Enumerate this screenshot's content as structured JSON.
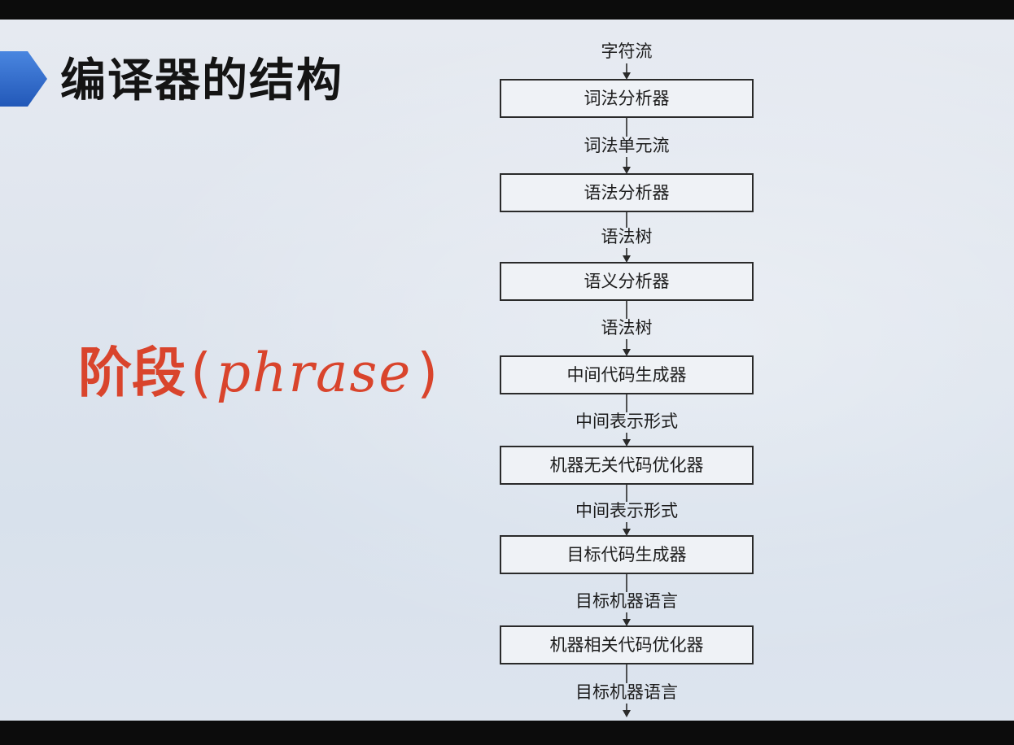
{
  "slide": {
    "title": "编译器的结构",
    "phase_label": {
      "zh": "阶段",
      "open_paren": "(",
      "en": "phrase",
      "close_paren": ")"
    },
    "colors": {
      "title": "#141414",
      "phase_label": "#d9442c",
      "title_marker": "#2f6fd1"
    }
  },
  "flowchart": {
    "input": "字符流",
    "stages": [
      {
        "name": "词法分析器",
        "output": "词法单元流"
      },
      {
        "name": "语法分析器",
        "output": "语法树"
      },
      {
        "name": "语义分析器",
        "output": "语法树"
      },
      {
        "name": "中间代码生成器",
        "output": "中间表示形式"
      },
      {
        "name": "机器无关代码优化器",
        "output": "中间表示形式"
      },
      {
        "name": "目标代码生成器",
        "output": "目标机器语言"
      },
      {
        "name": "机器相关代码优化器",
        "output": "目标机器语言"
      }
    ]
  }
}
